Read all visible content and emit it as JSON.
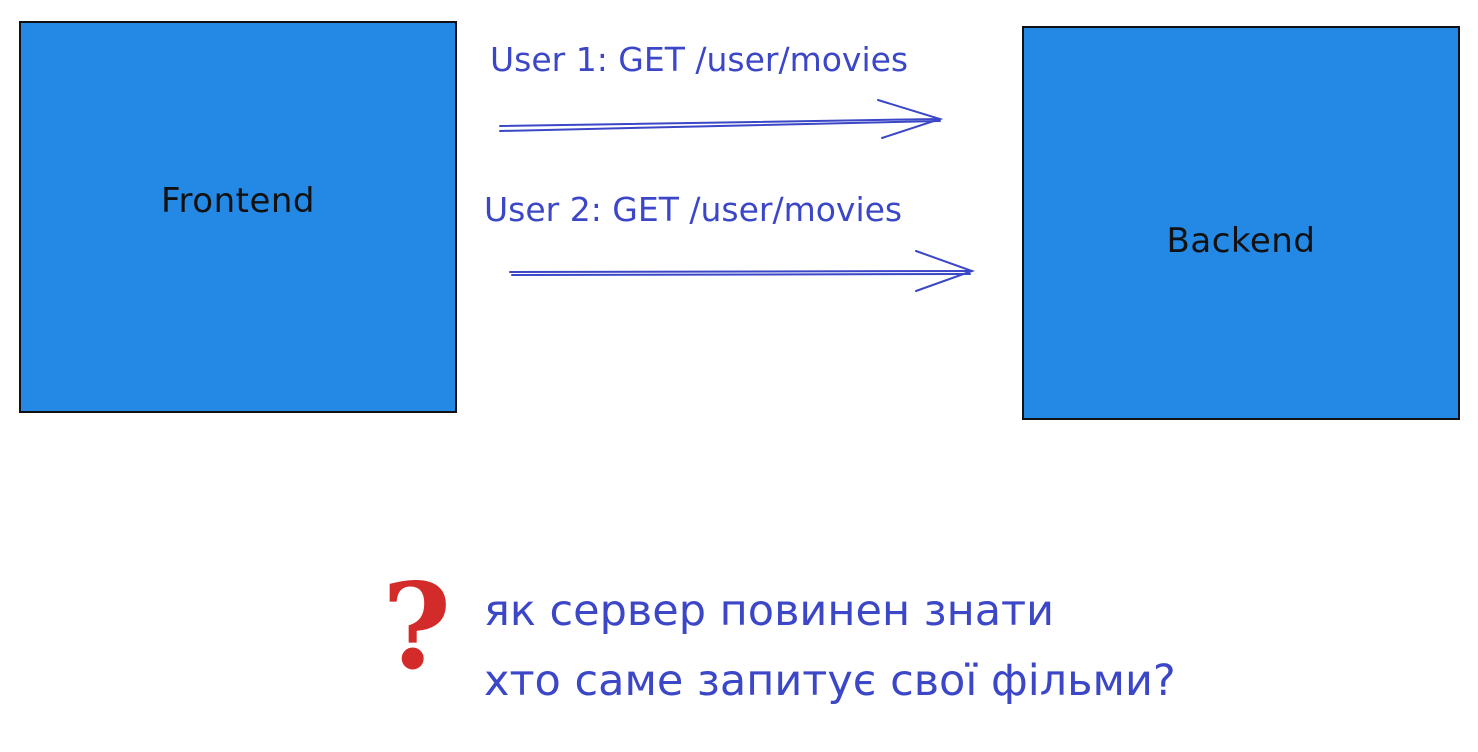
{
  "frontend": {
    "label": "Frontend"
  },
  "backend": {
    "label": "Backend"
  },
  "requests": [
    {
      "label": "User 1: GET /user/movies"
    },
    {
      "label": "User 2: GET /user/movies"
    }
  ],
  "question": {
    "mark": "?",
    "lines": [
      "як сервер повинен знати",
      "хто саме запитує свої фільми?"
    ]
  },
  "colors": {
    "box_fill": "#2389e5",
    "box_border": "#111111",
    "arrow": "#3b47c7",
    "text_blue": "#3b47c7",
    "question_mark": "#d32a2a"
  }
}
